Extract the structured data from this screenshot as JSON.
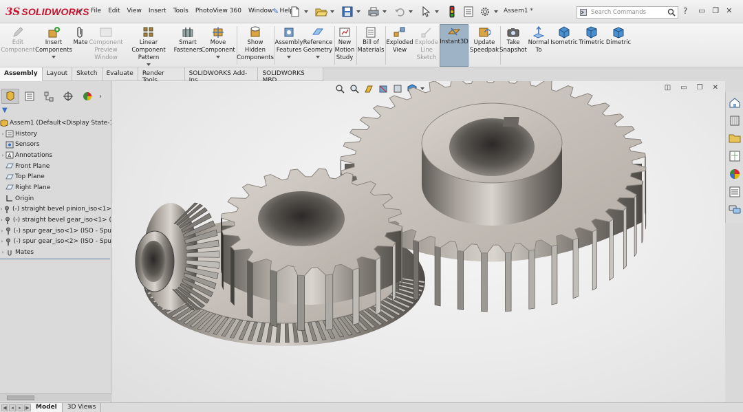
{
  "app": {
    "brand_mark": "3S",
    "brand_name": "SOLIDWORKS",
    "document_title": "Assem1 *"
  },
  "menu": [
    "File",
    "Edit",
    "View",
    "Insert",
    "Tools",
    "PhotoView 360",
    "Window",
    "Help"
  ],
  "search": {
    "placeholder": "Search Commands"
  },
  "help_glyph": "?",
  "window_controls": {
    "minimize": "▭",
    "restore": "❐",
    "close": "✕"
  },
  "toolbar": {
    "edit_component": "Edit\nComponent",
    "insert_components": "Insert\nComponents",
    "mate": "Mate",
    "component_preview": "Component\nPreview\nWindow",
    "linear_pattern": "Linear Component\nPattern",
    "smart_fasteners": "Smart\nFasteners",
    "move_component": "Move\nComponent",
    "show_hidden": "Show\nHidden\nComponents",
    "assembly_features": "Assembly\nFeatures",
    "reference_geometry": "Reference\nGeometry",
    "new_motion_study": "New\nMotion\nStudy",
    "bill_of_materials": "Bill of\nMaterials",
    "exploded_view": "Exploded\nView",
    "explode_line_sketch": "Explode\nLine\nSketch",
    "instant3d": "Instant3D",
    "update_speedpak": "Update\nSpeedpak",
    "take_snapshot": "Take\nSnapshot",
    "normal_to": "Normal\nTo",
    "isometric": "Isometric",
    "trimetric": "Trimetric",
    "dimetric": "Dimetric"
  },
  "tabs": [
    "Assembly",
    "Layout",
    "Sketch",
    "Evaluate",
    "Render Tools",
    "SOLIDWORKS Add-Ins",
    "SOLIDWORKS MBD"
  ],
  "feature_tree": {
    "more_glyph": "›",
    "filter_glyph": "▼",
    "items": [
      {
        "expand": "",
        "label": "Assem1  (Default<Display State-1>"
      },
      {
        "expand": "›",
        "label": "History"
      },
      {
        "expand": "",
        "label": "Sensors"
      },
      {
        "expand": "›",
        "label": "Annotations"
      },
      {
        "expand": "",
        "label": "Front Plane"
      },
      {
        "expand": "",
        "label": "Top Plane"
      },
      {
        "expand": "",
        "label": "Right Plane"
      },
      {
        "expand": "",
        "label": "Origin"
      },
      {
        "expand": "›",
        "label": "(-) straight bevel pinion_iso<1>"
      },
      {
        "expand": "›",
        "label": "(-) straight bevel gear_iso<1> ("
      },
      {
        "expand": "›",
        "label": "(-) spur gear_iso<1> (ISO - Spu"
      },
      {
        "expand": "›",
        "label": "(-) spur gear_iso<2> (ISO - Spu"
      },
      {
        "expand": "›",
        "label": "Mates"
      }
    ]
  },
  "bottom_tabs": [
    "Model",
    "3D Views"
  ],
  "colors": {
    "brand_red": "#c8102e",
    "gear_metal": "#8f8a85",
    "viewport_bg": "#ececec",
    "active_tool": "#9fb3c6"
  }
}
